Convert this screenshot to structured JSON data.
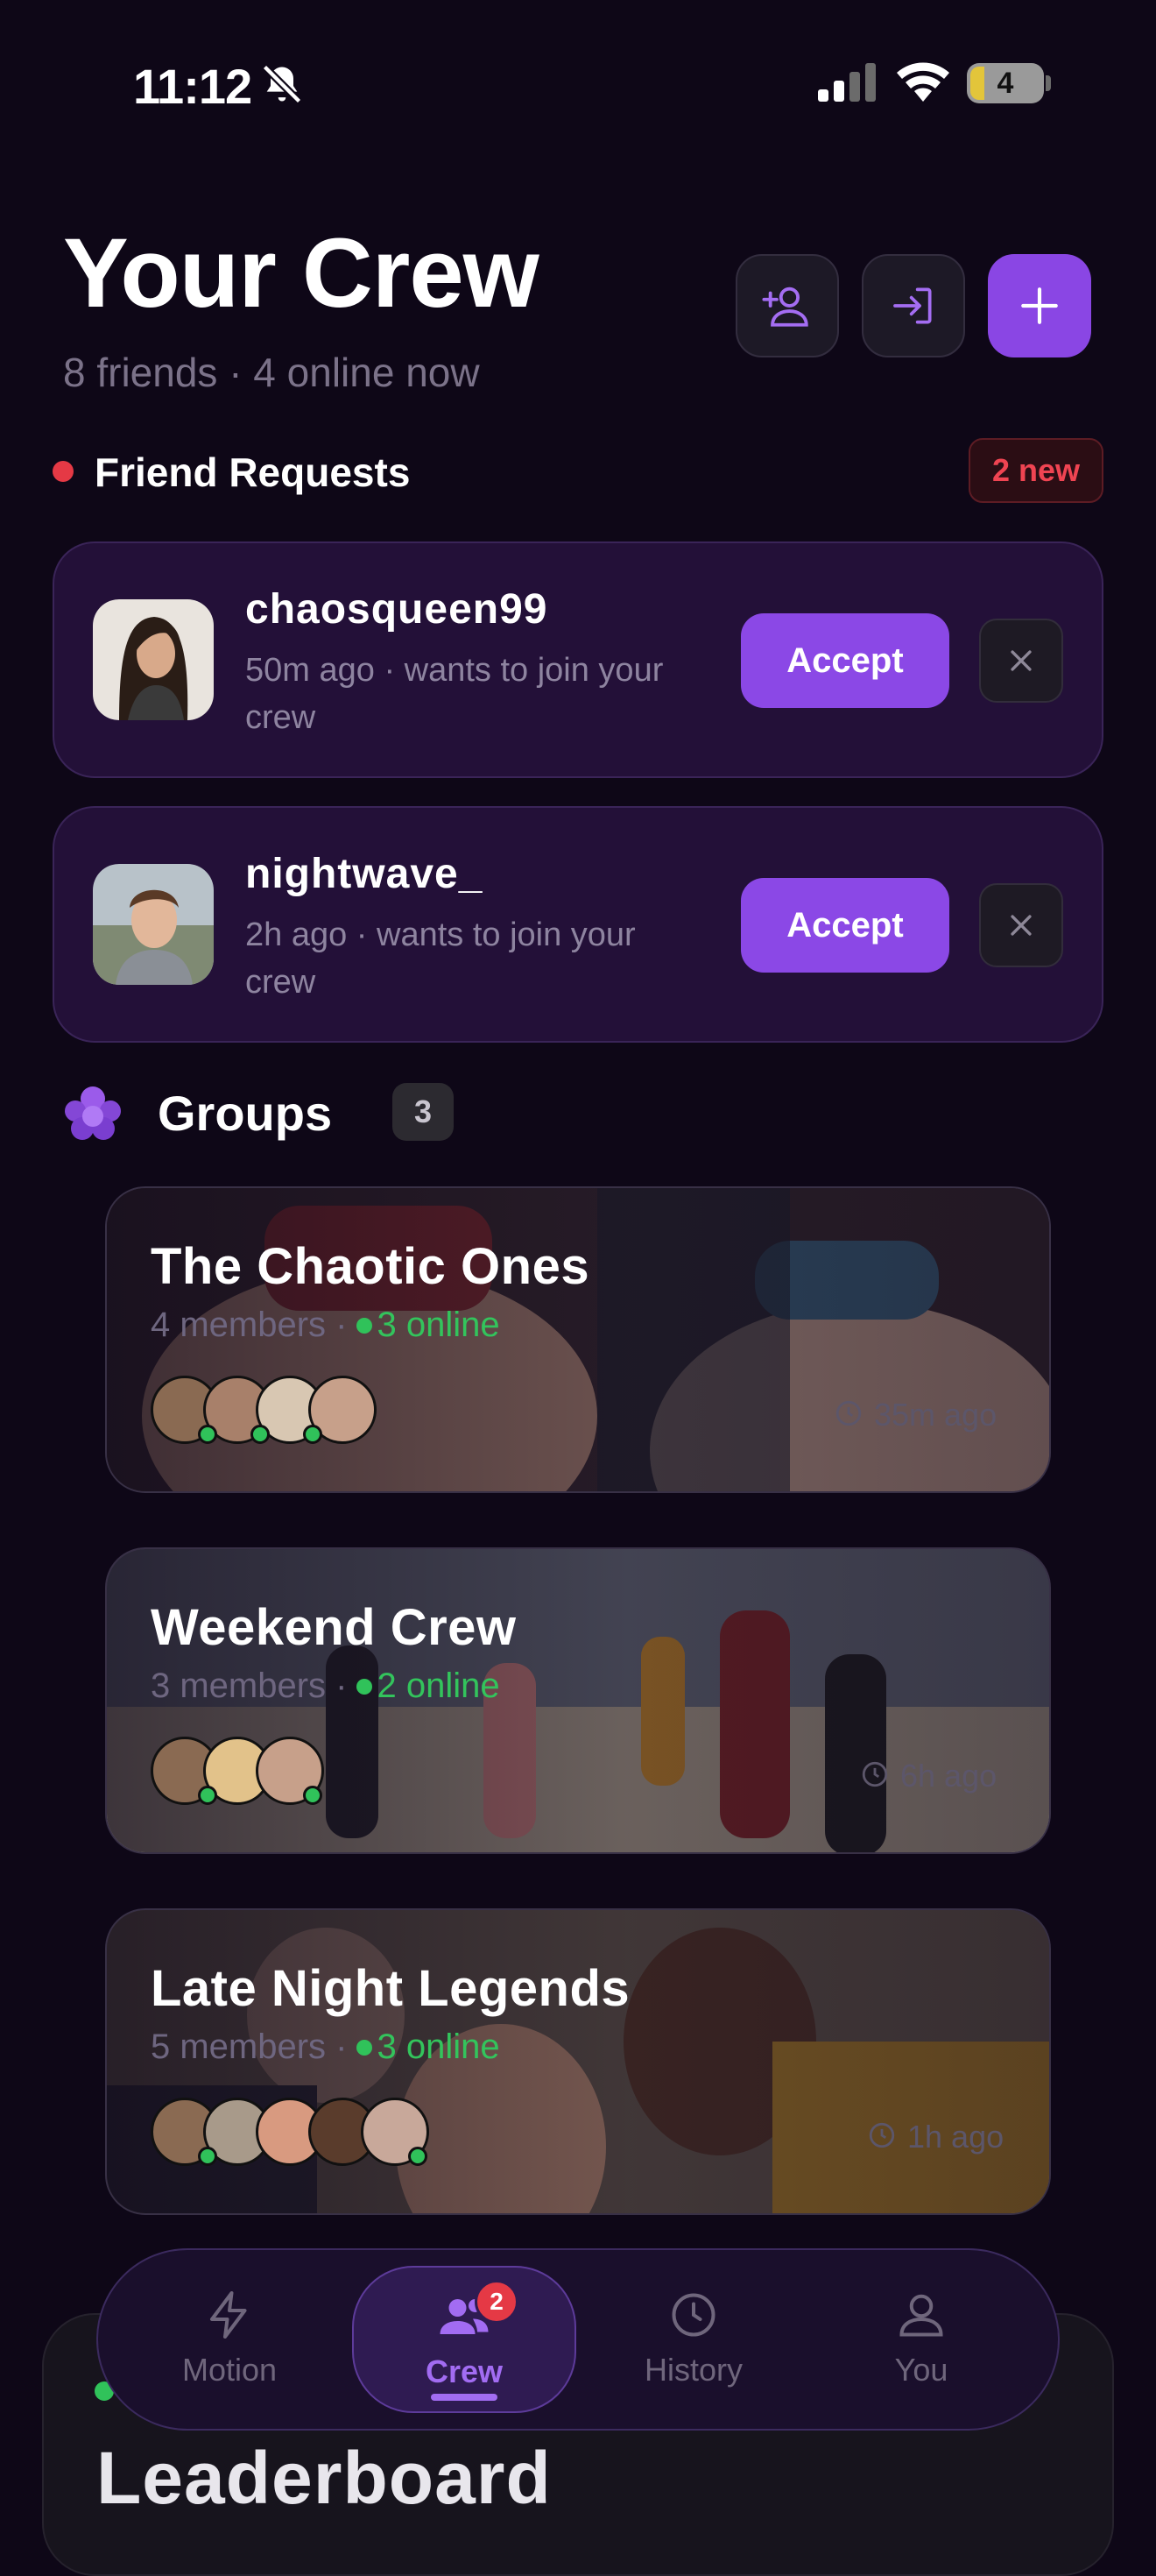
{
  "status_bar": {
    "time": "11:12",
    "battery": "4"
  },
  "header": {
    "title": "Your Crew",
    "subtitle": "8 friends · 4 online now"
  },
  "header_actions": [
    "add-friend",
    "join-group",
    "create-group"
  ],
  "friend_requests": {
    "title": "Friend Requests",
    "badge": "2 new",
    "items": [
      {
        "name": "chaosqueen99",
        "meta": "50m ago · wants to join your crew",
        "accept_label": "Accept"
      },
      {
        "name": "nightwave_",
        "meta": "2h ago · wants to join your crew",
        "accept_label": "Accept"
      }
    ]
  },
  "groups": {
    "title": "Groups",
    "count": "3",
    "items": [
      {
        "name": "The Chaotic Ones",
        "members": "4 members ·",
        "online": "3 online",
        "time": "35m ago"
      },
      {
        "name": "Weekend Crew",
        "members": "3 members ·",
        "online": "2 online",
        "time": "6h ago"
      },
      {
        "name": "Late Night Legends",
        "members": "5 members ·",
        "online": "3 online",
        "time": "1h ago"
      }
    ]
  },
  "leaderboard": {
    "title": "Leaderboard"
  },
  "tabbar": {
    "tabs": [
      {
        "label": "Motion"
      },
      {
        "label": "Crew",
        "badge": "2"
      },
      {
        "label": "History"
      },
      {
        "label": "You"
      }
    ]
  },
  "colors": {
    "accent": "#8b48e6",
    "online": "#30c25a",
    "alert": "#e53945",
    "background": "#0e0717"
  }
}
